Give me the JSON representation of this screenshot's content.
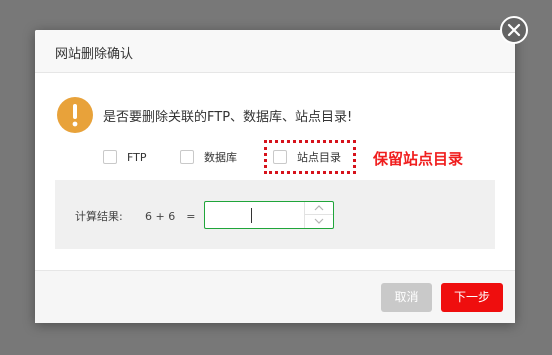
{
  "dialog": {
    "title": "网站删除确认",
    "question": "是否要删除关联的FTP、数据库、站点目录!",
    "options": [
      {
        "label": "FTP",
        "checked": false
      },
      {
        "label": "数据库",
        "checked": false
      },
      {
        "label": "站点目录",
        "checked": false
      }
    ],
    "annotation": "保留站点目录",
    "calc": {
      "label": "计算结果:",
      "expression": "6 + 6　=",
      "answer_value": ""
    },
    "buttons": {
      "cancel": "取消",
      "next": "下一步"
    }
  },
  "colors": {
    "overlay": "#787878",
    "warning": "#e8a23a",
    "input_border": "#20a53a",
    "primary_button": "#ef0e0e",
    "annotation": "#f01e1e"
  },
  "icons": {
    "close": "close-icon",
    "warning": "exclamation-icon",
    "spinner_up": "chevron-up-icon",
    "spinner_down": "chevron-down-icon"
  }
}
